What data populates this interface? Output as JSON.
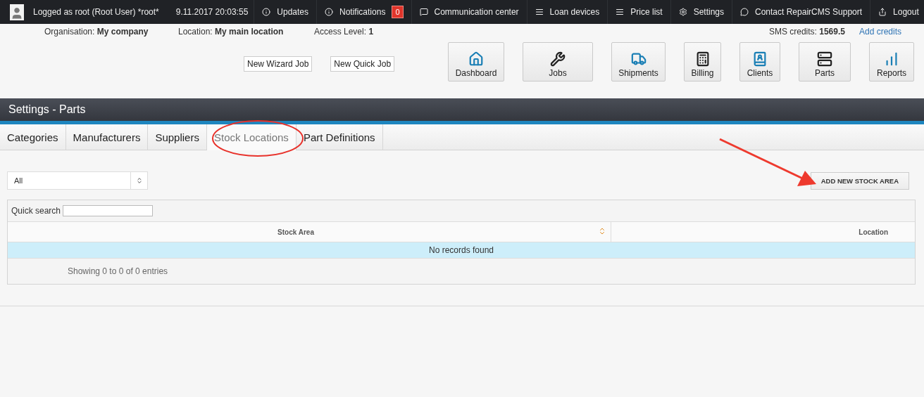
{
  "top_bar": {
    "user": "Logged as root (Root User) *root*",
    "datetime": "9.11.2017 20:03:55",
    "items": [
      {
        "label": "Updates"
      },
      {
        "label": "Notifications",
        "badge": "0"
      },
      {
        "label": "Communication center"
      },
      {
        "label": "Loan devices"
      },
      {
        "label": "Price list"
      },
      {
        "label": "Settings"
      },
      {
        "label": "Contact RepairCMS Support"
      },
      {
        "label": "Logout"
      }
    ]
  },
  "info_bar": {
    "organisation": "Organisation: **My company**",
    "location": "Location: **My main location**",
    "access_level": "Access Level: **1**",
    "sms_credits": "SMS credits: **1569.5**",
    "add_credits": "Add credits"
  },
  "quick_buttons": [
    "New Wizard Job",
    "New Quick Job"
  ],
  "modules": [
    {
      "label": "Dashboard"
    },
    {
      "label": "Jobs"
    },
    {
      "label": "Shipments"
    },
    {
      "label": "Billing"
    },
    {
      "label": "Clients"
    },
    {
      "label": "Parts"
    },
    {
      "label": "Reports"
    }
  ],
  "page_title": "Settings - Parts",
  "tabs": [
    {
      "label": "Categories",
      "selected": false
    },
    {
      "label": "Manufacturers",
      "selected": false
    },
    {
      "label": "Suppliers",
      "selected": false
    },
    {
      "label": "Stock Locations",
      "selected": true
    },
    {
      "label": "Part Definitions",
      "selected": false
    }
  ],
  "filter_select": {
    "value": "All"
  },
  "add_button": "ADD NEW STOCK AREA",
  "table": {
    "quick_search_label": "Quick search",
    "columns": [
      {
        "label": "Stock Area",
        "sortable": true
      },
      {
        "label": "Location",
        "sortable": false
      }
    ],
    "empty_message": "No records found",
    "footer": "Showing 0 to 0 of 0 entries"
  }
}
